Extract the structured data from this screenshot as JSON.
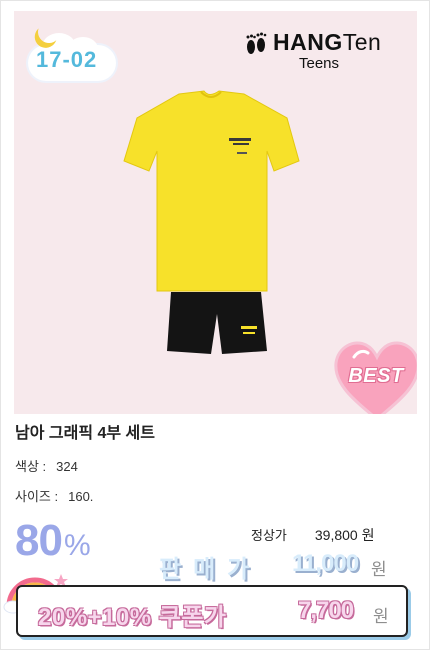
{
  "badge": {
    "code": "17-02",
    "icon": "moon-icon"
  },
  "brand": {
    "name_bold": "HANG",
    "name_light": "Ten",
    "sub": "Teens",
    "icon": "feet-icon"
  },
  "product": {
    "title": "남아 그래픽 4부 세트",
    "best_label": "BEST",
    "image_icon": "product-image",
    "colors": {
      "shirt": "#f7e12a",
      "shorts": "#141414",
      "background": "#f7e9ec"
    }
  },
  "attributes": {
    "color_label": "색상 :",
    "color_value": "324",
    "size_label": "사이즈 :",
    "size_value": "160."
  },
  "pricing": {
    "discount_value": "80",
    "discount_unit": "%",
    "regular_label": "정상가",
    "regular_price": "39,800 원",
    "sale_label": "판매가",
    "sale_price": "11,000",
    "sale_unit": "원",
    "coupon_label": "20%+10% 쿠폰가",
    "coupon_price": "7,700",
    "coupon_unit": "원"
  }
}
